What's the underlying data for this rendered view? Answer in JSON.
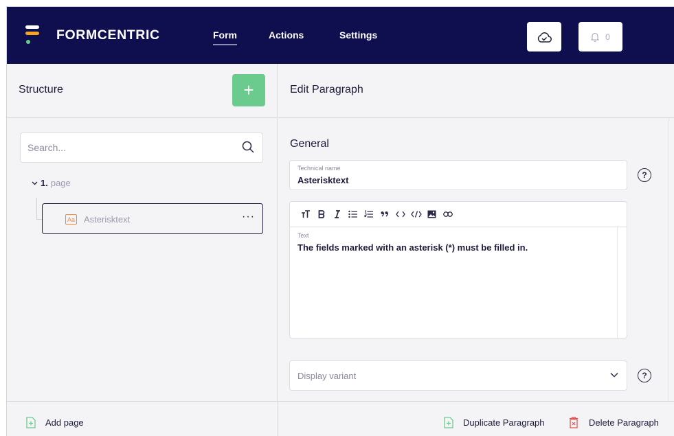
{
  "brand": {
    "name": "FORMCENTRIC"
  },
  "nav": [
    {
      "label": "Form",
      "active": true
    },
    {
      "label": "Actions",
      "active": false
    },
    {
      "label": "Settings",
      "active": false
    }
  ],
  "notifications": {
    "count": "0"
  },
  "structure": {
    "title": "Structure",
    "add_button": "+",
    "search_placeholder": "Search...",
    "page": {
      "number": "1.",
      "name": "page"
    },
    "items": [
      {
        "icon": "Aa",
        "label": "Asterisktext",
        "menu": "···"
      }
    ]
  },
  "editor": {
    "title": "Edit Paragraph",
    "section": "General",
    "technical_name": {
      "label": "Technical name",
      "value": "Asterisktext"
    },
    "text": {
      "label": "Text",
      "value": "The fields marked with an asterisk (*) must be filled in."
    },
    "display_variant": {
      "placeholder": "Display variant"
    },
    "help": "?"
  },
  "footer": {
    "add_page": "Add page",
    "duplicate": "Duplicate Paragraph",
    "delete": "Delete Paragraph"
  },
  "colors": {
    "topbar": "#0f0e4f",
    "accent_green": "#6bcb8f",
    "logo_orange": "#f5a623",
    "logo_green": "#6bcb8f",
    "danger": "#e0534f",
    "item_icon": "#ef8a3a"
  }
}
